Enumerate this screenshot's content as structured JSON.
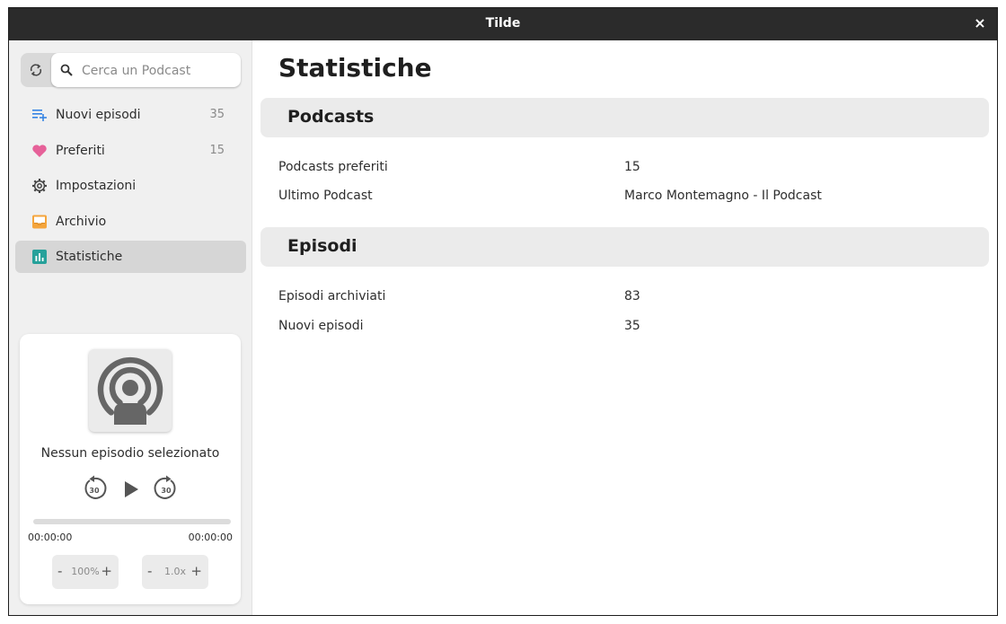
{
  "window": {
    "title": "Tilde",
    "close_label": "×"
  },
  "sidebar": {
    "search": {
      "placeholder": "Cerca un Podcast",
      "value": ""
    },
    "items": [
      {
        "label": "Nuovi episodi",
        "count": "35",
        "icon": "new-episodes-icon",
        "active": false
      },
      {
        "label": "Preferiti",
        "count": "15",
        "icon": "heart-icon",
        "active": false
      },
      {
        "label": "Impostazioni",
        "count": "",
        "icon": "gear-icon",
        "active": false
      },
      {
        "label": "Archivio",
        "count": "",
        "icon": "archive-icon",
        "active": false
      },
      {
        "label": "Statistiche",
        "count": "",
        "icon": "stats-icon",
        "active": true
      }
    ]
  },
  "player": {
    "cover_icon": "podcast-icon",
    "episode_title": "Nessun episodio selezionato",
    "rewind_seconds": "30",
    "forward_seconds": "30",
    "progress": 0,
    "time_elapsed": "00:00:00",
    "time_total": "00:00:00",
    "volume": {
      "minus": "-",
      "value": "100%",
      "plus": "+"
    },
    "speed": {
      "minus": "-",
      "value": "1.0x",
      "plus": "+"
    }
  },
  "main": {
    "title": "Statistiche",
    "sections": [
      {
        "title": "Podcasts",
        "rows": [
          {
            "label": "Podcasts preferiti",
            "value": "15"
          },
          {
            "label": "Ultimo Podcast",
            "value": "Marco Montemagno - Il Podcast"
          }
        ]
      },
      {
        "title": "Episodi",
        "rows": [
          {
            "label": "Episodi archiviati",
            "value": "83"
          },
          {
            "label": "Nuovi episodi",
            "value": "35"
          }
        ]
      }
    ]
  },
  "colors": {
    "titlebar": "#2b2b2b",
    "sidebar_bg": "#f0f0f0",
    "accent_blue": "#3584e4",
    "heart": "#e66199",
    "archive": "#f5a53c",
    "stats": "#26a19a"
  }
}
